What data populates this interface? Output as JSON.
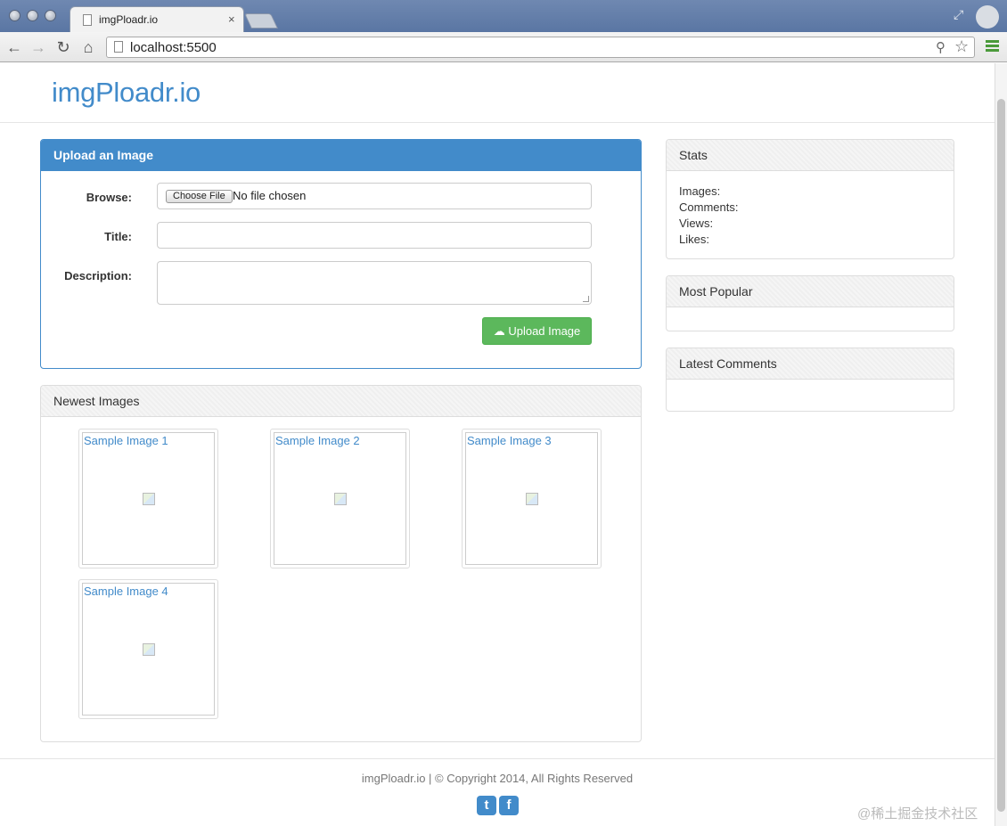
{
  "browser": {
    "tab_title": "imgPloadr.io",
    "tab_close": "×",
    "url": "localhost:5500"
  },
  "brand": "imgPloadr.io",
  "upload_panel": {
    "title": "Upload an Image",
    "browse_label": "Browse:",
    "choose_file_label": "Choose File",
    "no_file_text": "No file chosen",
    "title_label": "Title:",
    "description_label": "Description:",
    "upload_button": "Upload Image"
  },
  "newest_panel": {
    "title": "Newest Images",
    "images": [
      {
        "title": "Sample Image 1"
      },
      {
        "title": "Sample Image 2"
      },
      {
        "title": "Sample Image 3"
      },
      {
        "title": "Sample Image 4"
      }
    ]
  },
  "stats_panel": {
    "title": "Stats",
    "lines": [
      "Images:",
      "Comments:",
      "Views:",
      "Likes:"
    ]
  },
  "popular_panel": {
    "title": "Most Popular"
  },
  "comments_panel": {
    "title": "Latest Comments"
  },
  "footer": {
    "text": "imgPloadr.io | © Copyright 2014, All Rights Reserved",
    "twitter": "t",
    "facebook": "f"
  },
  "watermark": "@稀土掘金技术社区",
  "icons": {
    "back": "back-arrow-icon",
    "forward": "forward-arrow-icon",
    "reload": "reload-icon",
    "home": "home-icon",
    "star": "star-icon",
    "menu": "menu-icon",
    "upload": "cloud-upload-icon"
  },
  "colors": {
    "primary": "#428bca",
    "success": "#5cb85c"
  }
}
